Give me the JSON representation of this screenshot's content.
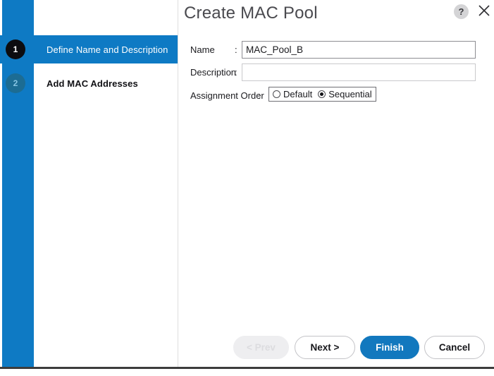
{
  "dialog": {
    "title": "Create MAC Pool",
    "help_icon_label": "?",
    "close_icon_name": "close-icon"
  },
  "wizard": {
    "steps": [
      {
        "number": "1",
        "label": "Define Name and Description",
        "state": "active"
      },
      {
        "number": "2",
        "label": "Add MAC Addresses",
        "state": "pending"
      }
    ]
  },
  "form": {
    "name": {
      "label": "Name",
      "separator": ":",
      "value": "MAC_Pool_B",
      "placeholder": ""
    },
    "description": {
      "label": "Description",
      "separator": ":",
      "value": "",
      "placeholder": ""
    },
    "assignment_order": {
      "label": "Assignment Order",
      "separator": ":",
      "options": [
        {
          "label": "Default",
          "selected": false
        },
        {
          "label": "Sequential",
          "selected": true
        }
      ]
    }
  },
  "footer": {
    "prev_label": "< Prev",
    "next_label": "Next >",
    "finish_label": "Finish",
    "cancel_label": "Cancel"
  },
  "colors": {
    "accent_blue": "#0e7ac4",
    "primary_button": "#1278be",
    "step_done": "#0c0c10",
    "step_pending": "#1c6c93",
    "border_gray": "#c3c3c7"
  }
}
